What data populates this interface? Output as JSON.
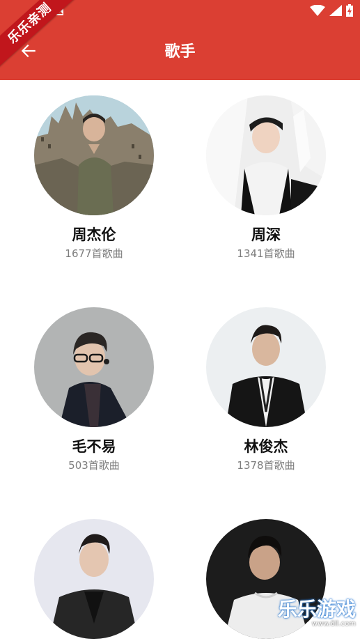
{
  "app": {
    "title": "歌手",
    "ribbon_text": "乐乐亲测"
  },
  "singers": [
    {
      "name": "周杰伦",
      "count": "1677首歌曲"
    },
    {
      "name": "周深",
      "count": "1341首歌曲"
    },
    {
      "name": "毛不易",
      "count": "503首歌曲"
    },
    {
      "name": "林俊杰",
      "count": "1378首歌曲"
    },
    {
      "name": "",
      "count": ""
    },
    {
      "name": "",
      "count": ""
    }
  ],
  "watermark": {
    "title": "乐乐游戏",
    "url": "www.6ll.com"
  },
  "colors": {
    "topbar": "#db3f33",
    "ribbon": "#c1161c",
    "subtext": "#7d7d7d"
  },
  "icons": {
    "back": "arrow-left-icon",
    "wifi": "wifi-icon",
    "signal": "signal-icon",
    "battery": "battery-icon"
  }
}
